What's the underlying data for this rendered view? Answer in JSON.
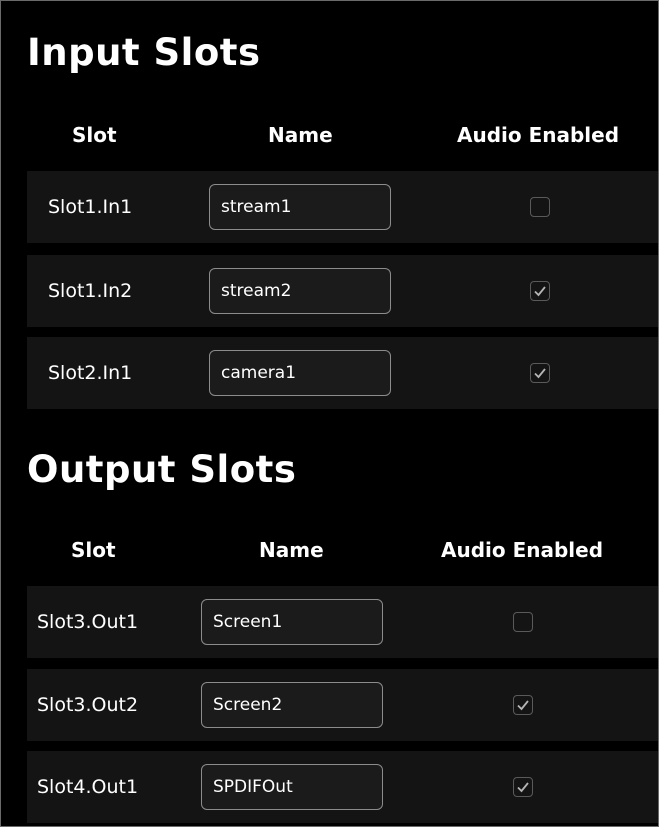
{
  "input_section": {
    "title": "Input Slots",
    "headers": {
      "slot": "Slot",
      "name": "Name",
      "audio": "Audio Enabled"
    },
    "rows": [
      {
        "slot": "Slot1.In1",
        "name": "stream1",
        "audio_enabled": false
      },
      {
        "slot": "Slot1.In2",
        "name": "stream2",
        "audio_enabled": true
      },
      {
        "slot": "Slot2.In1",
        "name": "camera1",
        "audio_enabled": true
      }
    ]
  },
  "output_section": {
    "title": "Output Slots",
    "headers": {
      "slot": "Slot",
      "name": "Name",
      "audio": "Audio Enabled"
    },
    "rows": [
      {
        "slot": "Slot3.Out1",
        "name": "Screen1",
        "audio_enabled": false
      },
      {
        "slot": "Slot3.Out2",
        "name": "Screen2",
        "audio_enabled": true
      },
      {
        "slot": "Slot4.Out1",
        "name": "SPDIFOut",
        "audio_enabled": true
      }
    ]
  },
  "colors": {
    "background": "#000000",
    "row_background": "#141414",
    "input_border": "#8c8c8c",
    "checkbox_border": "#5a5a5a",
    "checkmark": "#b5b5b5"
  }
}
